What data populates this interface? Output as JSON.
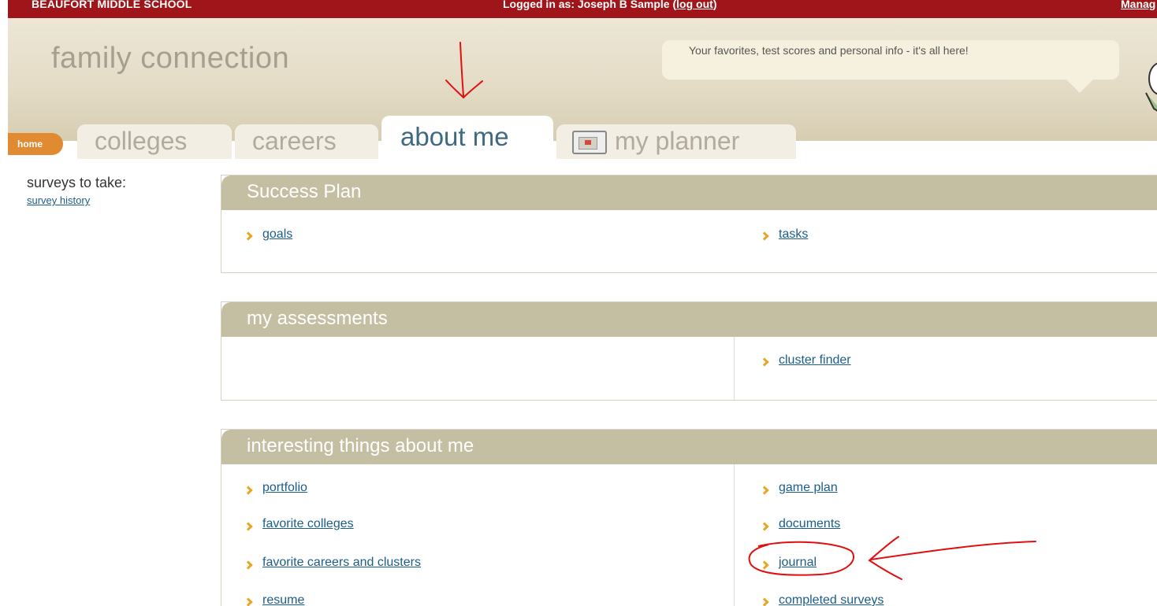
{
  "topbar": {
    "school": "BEAUFORT MIDDLE SCHOOL",
    "logged_prefix": "Logged in as: Joseph B Sample (",
    "logout_link": "log out",
    "logged_suffix": ")",
    "manage": "Manag"
  },
  "header": {
    "brand": "family connection",
    "bubble_text": "Your favorites, test scores and personal info - it's all here!"
  },
  "tabs": {
    "home": "home",
    "colleges": "colleges",
    "careers": "careers",
    "about_me": "about me",
    "my_planner": "my planner"
  },
  "sidebar": {
    "title": "surveys to take:",
    "survey_history": "survey history"
  },
  "panels": {
    "success_plan": {
      "title": "Success Plan",
      "links": [
        "goals",
        "tasks"
      ]
    },
    "my_assessments": {
      "title": "my assessments",
      "links": [
        "cluster finder"
      ]
    },
    "interesting": {
      "title": "interesting things about me",
      "left_links": [
        "portfolio",
        "favorite colleges",
        "favorite careers and clusters",
        "resume"
      ],
      "right_links": [
        "game plan",
        "documents",
        "journal",
        "completed surveys"
      ]
    }
  },
  "colors": {
    "topbar": "#a01519",
    "panel_header": "#c4bea2",
    "link": "#1b5d8a",
    "chevron": "#e8a624",
    "active_tab_text": "#3d6a7e",
    "annotation": "#e01010"
  }
}
